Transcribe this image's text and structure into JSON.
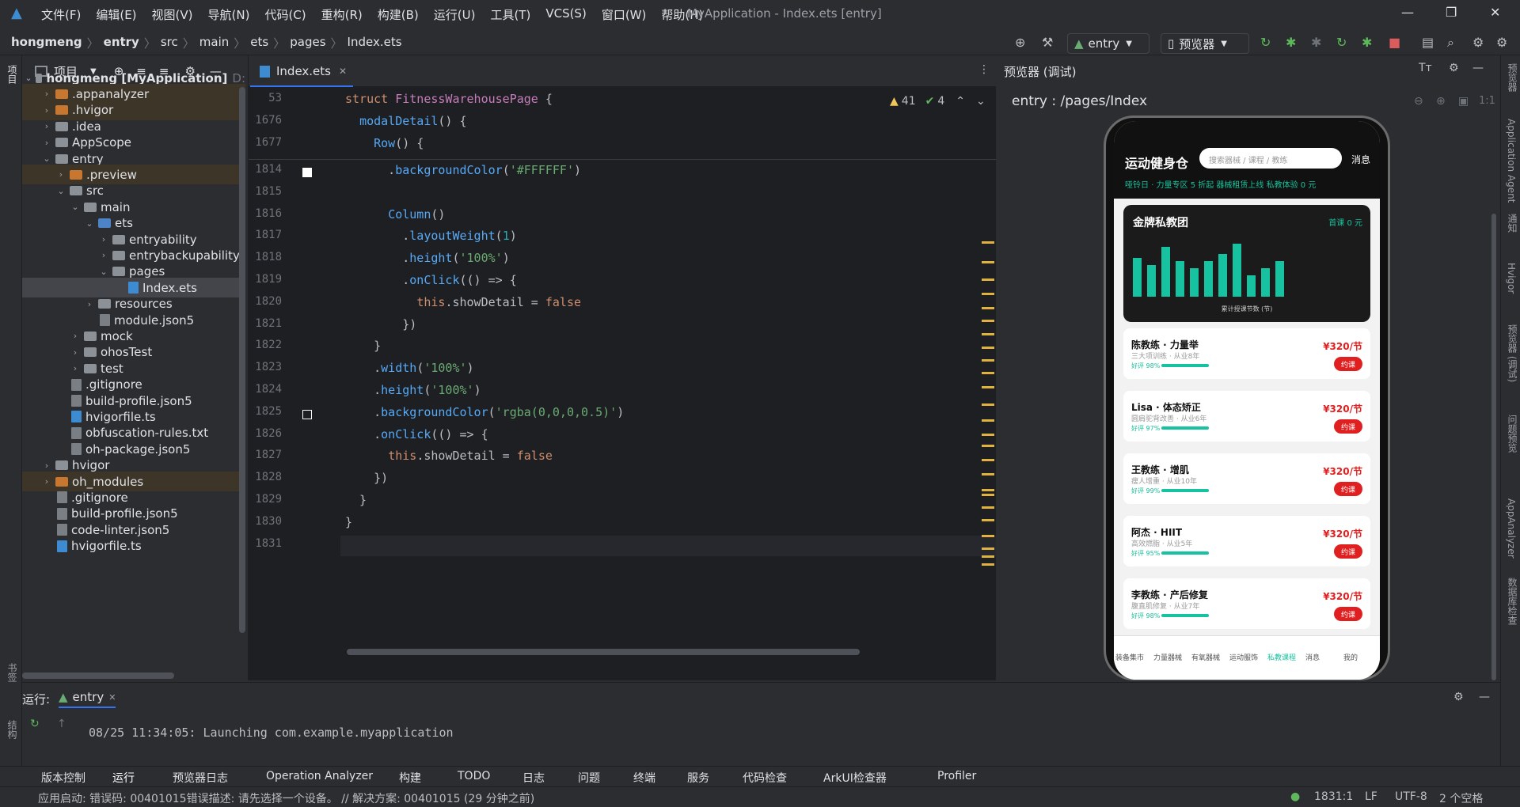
{
  "menu": {
    "items": [
      "文件(F)",
      "编辑(E)",
      "视图(V)",
      "导航(N)",
      "代码(C)",
      "重构(R)",
      "构建(B)",
      "运行(U)",
      "工具(T)",
      "VCS(S)",
      "窗口(W)",
      "帮助(H)"
    ],
    "window_title": "MyApplication - Index.ets [entry]"
  },
  "breadcrumb": [
    "hongmeng",
    "entry",
    "src",
    "main",
    "ets",
    "pages",
    "Index.ets"
  ],
  "toolbar": {
    "module_select": "entry",
    "device_select": "预览器"
  },
  "project_panel": {
    "title": "项目",
    "tree": [
      {
        "label": "hongmeng [MyApplication]",
        "suffix": "D:",
        "depth": 0,
        "type": "root",
        "expanded": true
      },
      {
        "label": ".appanalyzer",
        "depth": 1,
        "type": "folder-orange",
        "collapsed": true
      },
      {
        "label": ".hvigor",
        "depth": 1,
        "type": "folder-orange",
        "collapsed": true
      },
      {
        "label": ".idea",
        "depth": 1,
        "type": "folder",
        "collapsed": true
      },
      {
        "label": "AppScope",
        "depth": 1,
        "type": "folder",
        "collapsed": true
      },
      {
        "label": "entry",
        "depth": 1,
        "type": "folder",
        "expanded": true
      },
      {
        "label": ".preview",
        "depth": 2,
        "type": "folder-orange",
        "collapsed": true
      },
      {
        "label": "src",
        "depth": 2,
        "type": "folder",
        "expanded": true
      },
      {
        "label": "main",
        "depth": 3,
        "type": "folder",
        "expanded": true
      },
      {
        "label": "ets",
        "depth": 4,
        "type": "folder-blue",
        "expanded": true
      },
      {
        "label": "entryability",
        "depth": 5,
        "type": "folder",
        "collapsed": true
      },
      {
        "label": "entrybackupability",
        "depth": 5,
        "type": "folder",
        "collapsed": true
      },
      {
        "label": "pages",
        "depth": 5,
        "type": "folder",
        "expanded": true
      },
      {
        "label": "Index.ets",
        "depth": 6,
        "type": "file-ts"
      },
      {
        "label": "resources",
        "depth": 4,
        "type": "folder",
        "collapsed": true
      },
      {
        "label": "module.json5",
        "depth": 4,
        "type": "file"
      },
      {
        "label": "mock",
        "depth": 3,
        "type": "folder",
        "collapsed": true
      },
      {
        "label": "ohosTest",
        "depth": 3,
        "type": "folder",
        "collapsed": true
      },
      {
        "label": "test",
        "depth": 3,
        "type": "folder",
        "collapsed": true
      },
      {
        "label": ".gitignore",
        "depth": 2,
        "type": "file"
      },
      {
        "label": "build-profile.json5",
        "depth": 2,
        "type": "file"
      },
      {
        "label": "hvigorfile.ts",
        "depth": 2,
        "type": "file-ts"
      },
      {
        "label": "obfuscation-rules.txt",
        "depth": 2,
        "type": "file"
      },
      {
        "label": "oh-package.json5",
        "depth": 2,
        "type": "file"
      },
      {
        "label": "hvigor",
        "depth": 1,
        "type": "folder",
        "collapsed": true
      },
      {
        "label": "oh_modules",
        "depth": 1,
        "type": "folder-orange",
        "collapsed": true
      },
      {
        "label": ".gitignore",
        "depth": 1,
        "type": "file"
      },
      {
        "label": "build-profile.json5",
        "depth": 1,
        "type": "file"
      },
      {
        "label": "code-linter.json5",
        "depth": 1,
        "type": "file"
      },
      {
        "label": "hvigorfile.ts",
        "depth": 1,
        "type": "file-ts"
      }
    ]
  },
  "editor": {
    "tab": "Index.ets",
    "warnings": "41",
    "checks": "4",
    "sticky": [
      {
        "ln": "53",
        "html": "<span class='kw'>struct</span> <span class='typ'>FitnessWarehousePage</span> {"
      },
      {
        "ln": "1676",
        "html": "  <span class='fn'>modalDetail</span>() {"
      },
      {
        "ln": "1677",
        "html": "    <span class='fn'>Row</span>() {"
      }
    ],
    "lines": [
      {
        "ln": "1814",
        "html": "      .<span class='mtd'>backgroundColor</span>(<span class='str'>'#FFFFFF'</span>)"
      },
      {
        "ln": "1815",
        "html": ""
      },
      {
        "ln": "1816",
        "html": "      <span class='fn'>Column</span>()"
      },
      {
        "ln": "1817",
        "html": "        .<span class='mtd'>layoutWeight</span>(<span class='num'>1</span>)"
      },
      {
        "ln": "1818",
        "html": "        .<span class='mtd'>height</span>(<span class='str'>'100%'</span>)"
      },
      {
        "ln": "1819",
        "html": "        .<span class='mtd'>onClick</span>(() => {"
      },
      {
        "ln": "1820",
        "html": "          <span class='kw'>this</span>.showDetail = <span class='kw'>false</span>"
      },
      {
        "ln": "1821",
        "html": "        })"
      },
      {
        "ln": "1822",
        "html": "    }"
      },
      {
        "ln": "1823",
        "html": "    .<span class='mtd'>width</span>(<span class='str'>'100%'</span>)"
      },
      {
        "ln": "1824",
        "html": "    .<span class='mtd'>height</span>(<span class='str'>'100%'</span>)"
      },
      {
        "ln": "1825",
        "html": "    .<span class='mtd'>backgroundColor</span>(<span class='str'>'rgba(0,0,0,0.5)'</span>)"
      },
      {
        "ln": "1826",
        "html": "    .<span class='mtd'>onClick</span>(() => {"
      },
      {
        "ln": "1827",
        "html": "      <span class='kw'>this</span>.showDetail = <span class='kw'>false</span>"
      },
      {
        "ln": "1828",
        "html": "    })"
      },
      {
        "ln": "1829",
        "html": "  }"
      },
      {
        "ln": "1830",
        "html": "}"
      },
      {
        "ln": "1831",
        "html": ""
      }
    ]
  },
  "preview": {
    "header": "预览器 (调试)",
    "route": "entry : /pages/Index",
    "app": {
      "title": "运动健身仓",
      "search_placeholder": "搜索器械 / 课程 / 教练",
      "msg": "消息",
      "promo": "哑铃日 · 力量专区 5 折起    器械租赁上线    私教体验 0 元",
      "card_title": "金牌私教团",
      "card_sub": "首课 0 元",
      "card_caption": "累计授课节数 (节)",
      "bars": [
        0.55,
        0.45,
        0.7,
        0.5,
        0.4,
        0.5,
        0.6,
        0.75,
        0.3,
        0.4,
        0.5
      ],
      "coaches": [
        {
          "name": "陈教练 · 力量举",
          "desc": "三大项训练 · 从业8年",
          "rating": "好评 98%",
          "price": "¥320/节",
          "book": "约课"
        },
        {
          "name": "Lisa · 体态矫正",
          "desc": "圆肩驼背改善 · 从业6年",
          "rating": "好评 97%",
          "price": "¥320/节",
          "book": "约课"
        },
        {
          "name": "王教练 · 增肌",
          "desc": "瘦人增重 · 从业10年",
          "rating": "好评 99%",
          "price": "¥320/节",
          "book": "约课"
        },
        {
          "name": "阿杰 · HIIT",
          "desc": "高效燃脂 · 从业5年",
          "rating": "好评 95%",
          "price": "¥320/节",
          "book": "约课"
        },
        {
          "name": "李教练 · 产后修复",
          "desc": "腹直肌修复 · 从业7年",
          "rating": "好评 98%",
          "price": "¥320/节",
          "book": "约课"
        }
      ],
      "tabs": [
        "装备集市",
        "力量器械",
        "有氧器械",
        "运动服饰",
        "私教课程",
        "消息",
        "我的"
      ],
      "active_tab": "私教课程"
    }
  },
  "run_panel": {
    "label": "运行:",
    "tab": "entry",
    "console": "08/25 11:34:05: Launching com.example.myapplication"
  },
  "tool_windows": [
    "版本控制",
    "运行",
    "预览器日志",
    "Operation Analyzer",
    "构建",
    "TODO",
    "日志",
    "问题",
    "终端",
    "服务",
    "代码检查",
    "ArkUI检查器",
    "Profiler"
  ],
  "right_strip": [
    "预览器",
    "Application Agent",
    "通知",
    "Hvigor",
    "预览器 (调试)",
    "问题预览",
    "AppAnalyzer",
    "数据库检查"
  ],
  "left_strip": [
    "项目",
    "书签",
    "结构"
  ],
  "status": {
    "message": "应用启动: 错误码: 00401015错误描述: 请先选择一个设备。 // 解决方案: 00401015 (29 分钟之前)",
    "position": "1831:1",
    "line_sep": "LF",
    "encoding": "UTF-8",
    "indent": "2 个空格"
  }
}
